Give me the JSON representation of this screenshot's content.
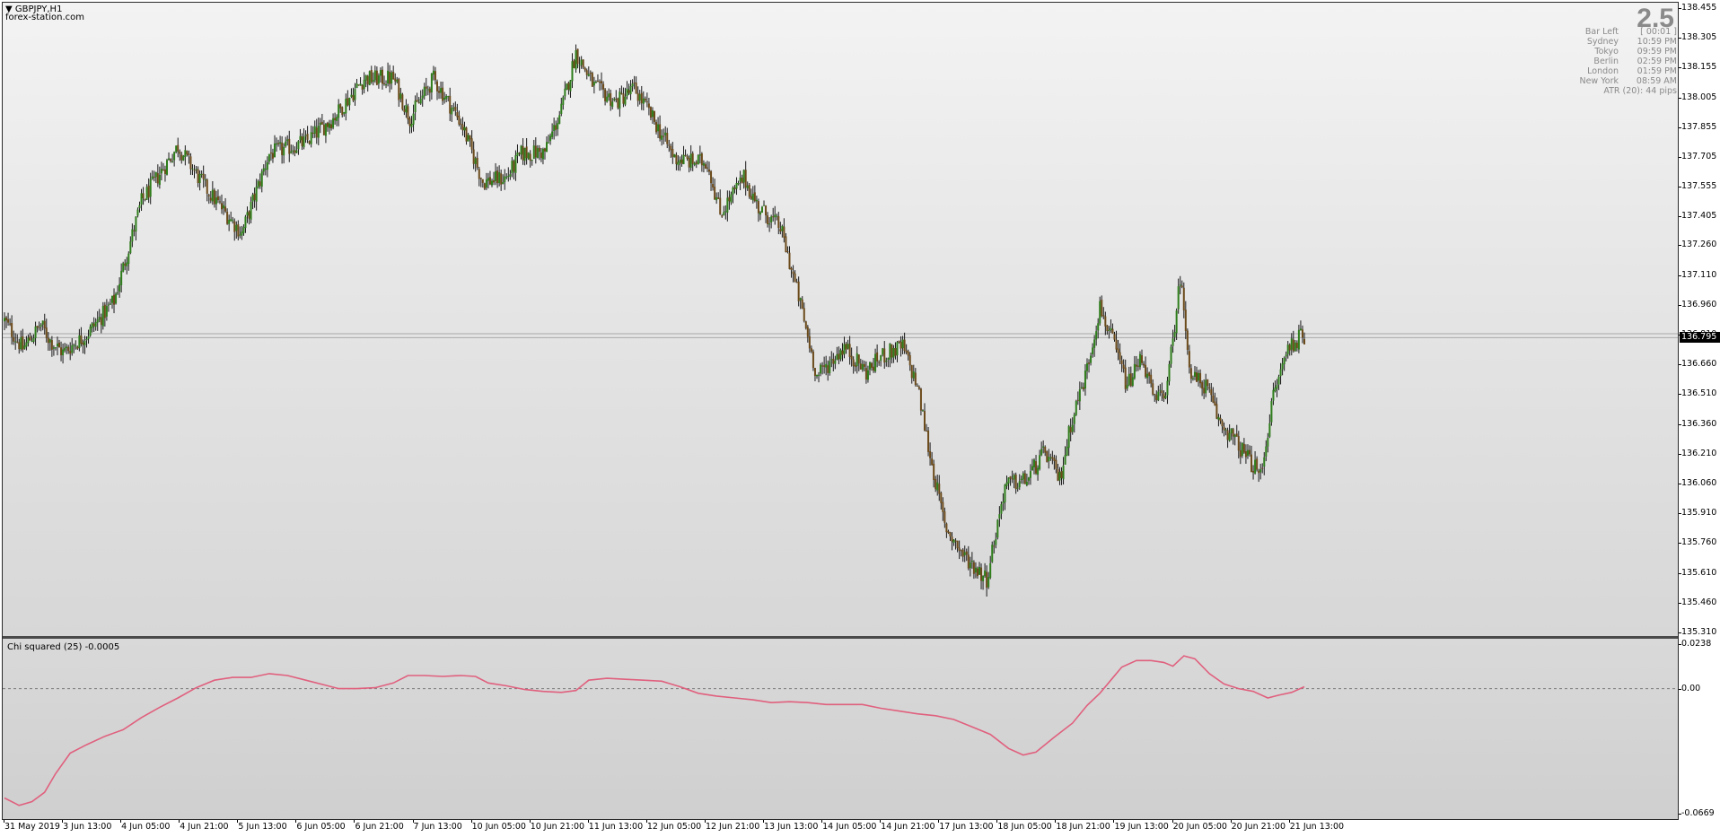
{
  "header": {
    "symbol_label": "GBPJPY,H1",
    "source": "forex-station.com"
  },
  "info_panel": {
    "big_value": "2.5",
    "rows": [
      {
        "label": "Bar Left",
        "value": "[ 00:01 ]"
      },
      {
        "label": "Sydney",
        "value": "10:59 PM"
      },
      {
        "label": "Tokyo",
        "value": "09:59 PM"
      },
      {
        "label": "Berlin",
        "value": "02:59 PM"
      },
      {
        "label": "London",
        "value": "01:59 PM"
      },
      {
        "label": "New York",
        "value": "08:59 AM"
      }
    ],
    "atr": "ATR (20): 44 pips"
  },
  "indicator": {
    "label": "Chi squared (25) -0.0005"
  },
  "colors": {
    "bull": "#2e7d1b",
    "bear": "#6b4a1a",
    "wick": "#1a1a1a",
    "indicator_line": "#e0607e",
    "price_line": "#a9a9a9"
  },
  "chart_data": [
    {
      "type": "candlestick",
      "symbol": "GBPJPY",
      "timeframe": "H1",
      "ylim": [
        135.31,
        138.455
      ],
      "y_ticks": [
        "138.455",
        "138.305",
        "138.155",
        "138.005",
        "137.855",
        "137.705",
        "137.555",
        "137.405",
        "137.260",
        "137.110",
        "136.960",
        "136.810",
        "136.660",
        "136.510",
        "136.360",
        "136.210",
        "136.060",
        "135.910",
        "135.760",
        "135.610",
        "135.460",
        "135.310"
      ],
      "current_price": "136.795",
      "x_ticks": [
        "31 May 2019",
        "3 Jun 13:00",
        "4 Jun 05:00",
        "4 Jun 21:00",
        "5 Jun 13:00",
        "6 Jun 05:00",
        "6 Jun 21:00",
        "7 Jun 13:00",
        "10 Jun 05:00",
        "10 Jun 21:00",
        "11 Jun 13:00",
        "12 Jun 05:00",
        "12 Jun 21:00",
        "13 Jun 13:00",
        "14 Jun 05:00",
        "14 Jun 21:00",
        "17 Jun 13:00",
        "18 Jun 05:00",
        "18 Jun 21:00",
        "19 Jun 13:00",
        "20 Jun 05:00",
        "20 Jun 21:00",
        "21 Jun 13:00"
      ],
      "close_anchors": [
        [
          0,
          136.88
        ],
        [
          10,
          136.74
        ],
        [
          20,
          136.86
        ],
        [
          25,
          136.78
        ],
        [
          32,
          136.72
        ],
        [
          45,
          136.81
        ],
        [
          60,
          136.98
        ],
        [
          75,
          137.48
        ],
        [
          95,
          137.76
        ],
        [
          110,
          137.55
        ],
        [
          130,
          137.32
        ],
        [
          145,
          137.72
        ],
        [
          165,
          137.78
        ],
        [
          180,
          137.9
        ],
        [
          197,
          138.1
        ],
        [
          213,
          138.1
        ],
        [
          222,
          137.9
        ],
        [
          235,
          138.1
        ],
        [
          250,
          137.88
        ],
        [
          262,
          137.58
        ],
        [
          275,
          137.6
        ],
        [
          283,
          137.72
        ],
        [
          296,
          137.73
        ],
        [
          305,
          137.94
        ],
        [
          313,
          138.23
        ],
        [
          323,
          138.06
        ],
        [
          335,
          137.98
        ],
        [
          345,
          138.05
        ],
        [
          355,
          137.9
        ],
        [
          367,
          137.7
        ],
        [
          376,
          137.68
        ],
        [
          385,
          137.68
        ],
        [
          392,
          137.42
        ],
        [
          405,
          137.6
        ],
        [
          413,
          137.45
        ],
        [
          425,
          137.35
        ],
        [
          435,
          137.0
        ],
        [
          445,
          136.6
        ],
        [
          460,
          136.75
        ],
        [
          472,
          136.62
        ],
        [
          480,
          136.7
        ],
        [
          492,
          136.75
        ],
        [
          500,
          136.55
        ],
        [
          507,
          136.2
        ],
        [
          515,
          135.85
        ],
        [
          525,
          135.7
        ],
        [
          538,
          135.58
        ],
        [
          548,
          136.05
        ],
        [
          560,
          136.08
        ],
        [
          570,
          136.22
        ],
        [
          578,
          136.08
        ],
        [
          585,
          136.4
        ],
        [
          592,
          136.6
        ],
        [
          600,
          136.95
        ],
        [
          608,
          136.75
        ],
        [
          615,
          136.55
        ],
        [
          623,
          136.7
        ],
        [
          630,
          136.47
        ],
        [
          637,
          136.55
        ],
        [
          644,
          137.1
        ],
        [
          650,
          136.6
        ],
        [
          658,
          136.55
        ],
        [
          665,
          136.38
        ],
        [
          672,
          136.3
        ],
        [
          680,
          136.2
        ],
        [
          688,
          136.1
        ],
        [
          695,
          136.5
        ],
        [
          703,
          136.75
        ],
        [
          710,
          136.8
        ]
      ],
      "bars": 713
    },
    {
      "type": "line",
      "name": "Chi squared (25)",
      "value_label": "-0.0005",
      "ylim": [
        -0.0669,
        0.0238
      ],
      "y_ticks": [
        "0.0238",
        "0.00",
        "-0.0669"
      ],
      "zero_line": 0.0,
      "x_index_range": [
        0,
        712
      ],
      "points": [
        [
          0,
          -0.0585
        ],
        [
          8,
          -0.0625
        ],
        [
          15,
          -0.0605
        ],
        [
          22,
          -0.0555
        ],
        [
          28,
          -0.0455
        ],
        [
          36,
          -0.0345
        ],
        [
          45,
          -0.03
        ],
        [
          55,
          -0.0255
        ],
        [
          65,
          -0.022
        ],
        [
          75,
          -0.0155
        ],
        [
          85,
          -0.01
        ],
        [
          95,
          -0.005
        ],
        [
          105,
          0.0005
        ],
        [
          115,
          0.0045
        ],
        [
          125,
          0.006
        ],
        [
          135,
          0.006
        ],
        [
          145,
          0.008
        ],
        [
          155,
          0.007
        ],
        [
          165,
          0.0045
        ],
        [
          175,
          0.002
        ],
        [
          183,
          0.0
        ],
        [
          193,
          0.0
        ],
        [
          203,
          0.0005
        ],
        [
          213,
          0.003
        ],
        [
          221,
          0.007
        ],
        [
          230,
          0.007
        ],
        [
          240,
          0.0065
        ],
        [
          250,
          0.007
        ],
        [
          258,
          0.0065
        ],
        [
          265,
          0.003
        ],
        [
          275,
          0.0015
        ],
        [
          285,
          -0.0005
        ],
        [
          295,
          -0.0015
        ],
        [
          305,
          -0.002
        ],
        [
          313,
          -0.001
        ],
        [
          320,
          0.0045
        ],
        [
          330,
          0.0055
        ],
        [
          340,
          0.005
        ],
        [
          350,
          0.0045
        ],
        [
          360,
          0.004
        ],
        [
          370,
          0.001
        ],
        [
          380,
          -0.0025
        ],
        [
          390,
          -0.004
        ],
        [
          400,
          -0.005
        ],
        [
          410,
          -0.006
        ],
        [
          420,
          -0.0075
        ],
        [
          430,
          -0.007
        ],
        [
          440,
          -0.0075
        ],
        [
          450,
          -0.0085
        ],
        [
          460,
          -0.0085
        ],
        [
          470,
          -0.0085
        ],
        [
          480,
          -0.0105
        ],
        [
          490,
          -0.012
        ],
        [
          500,
          -0.0135
        ],
        [
          510,
          -0.0145
        ],
        [
          520,
          -0.0165
        ],
        [
          530,
          -0.0205
        ],
        [
          540,
          -0.0245
        ],
        [
          550,
          -0.032
        ],
        [
          558,
          -0.0355
        ],
        [
          565,
          -0.034
        ],
        [
          575,
          -0.026
        ],
        [
          585,
          -0.0185
        ],
        [
          593,
          -0.009
        ],
        [
          600,
          -0.0025
        ],
        [
          606,
          0.0045
        ],
        [
          612,
          0.0115
        ],
        [
          620,
          0.015
        ],
        [
          628,
          0.015
        ],
        [
          635,
          0.014
        ],
        [
          640,
          0.012
        ],
        [
          646,
          0.0175
        ],
        [
          652,
          0.016
        ],
        [
          660,
          0.008
        ],
        [
          668,
          0.0025
        ],
        [
          676,
          0.0
        ],
        [
          684,
          -0.0015
        ],
        [
          692,
          -0.005
        ],
        [
          698,
          -0.0035
        ],
        [
          705,
          -0.002
        ],
        [
          712,
          0.001
        ]
      ]
    }
  ]
}
